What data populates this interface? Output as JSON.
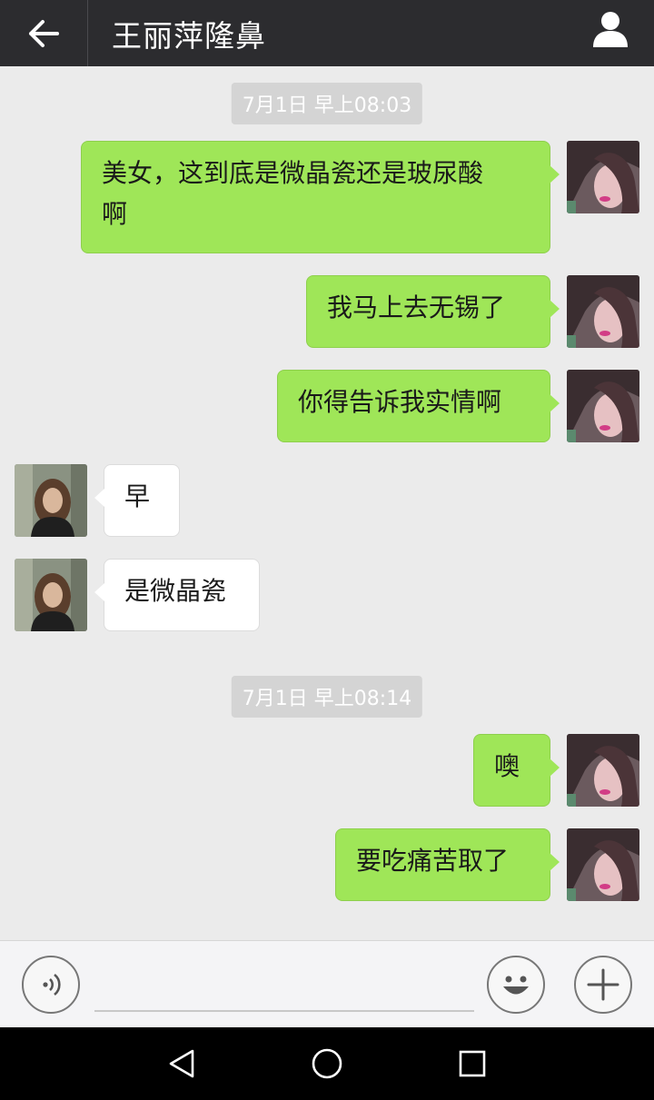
{
  "header": {
    "back_icon": "arrow-left-icon",
    "title": "王丽萍隆鼻",
    "profile_icon": "person-icon"
  },
  "timestamps": [
    "7月1日 早上08:03",
    "7月1日 早上08:14"
  ],
  "messages": [
    {
      "direction": "out",
      "lines": [
        "美女，这到底是微晶瓷还是玻尿酸",
        "啊"
      ]
    },
    {
      "direction": "out",
      "lines": [
        "我马上去无锡了"
      ]
    },
    {
      "direction": "out",
      "lines": [
        "你得告诉我实情啊"
      ]
    },
    {
      "direction": "in",
      "lines": [
        "早"
      ]
    },
    {
      "direction": "in",
      "lines": [
        "是微晶瓷"
      ]
    },
    {
      "direction": "out",
      "lines": [
        "噢"
      ]
    },
    {
      "direction": "out",
      "lines": [
        "要吃痛苦取了"
      ]
    }
  ],
  "input_bar": {
    "voice_icon": "voice-icon",
    "input_value": "",
    "emoji_icon": "emoji-icon",
    "plus_icon": "plus-icon"
  },
  "navbar": {
    "back_icon": "triangle-back-icon",
    "home_icon": "circle-home-icon",
    "recents_icon": "square-recents-icon"
  },
  "colors": {
    "header_bg": "#2c2c2f",
    "chat_bg": "#ebebeb",
    "outgoing_bubble": "#9fe658",
    "incoming_bubble": "#ffffff",
    "timestamp_bg": "#d4d4d4"
  }
}
